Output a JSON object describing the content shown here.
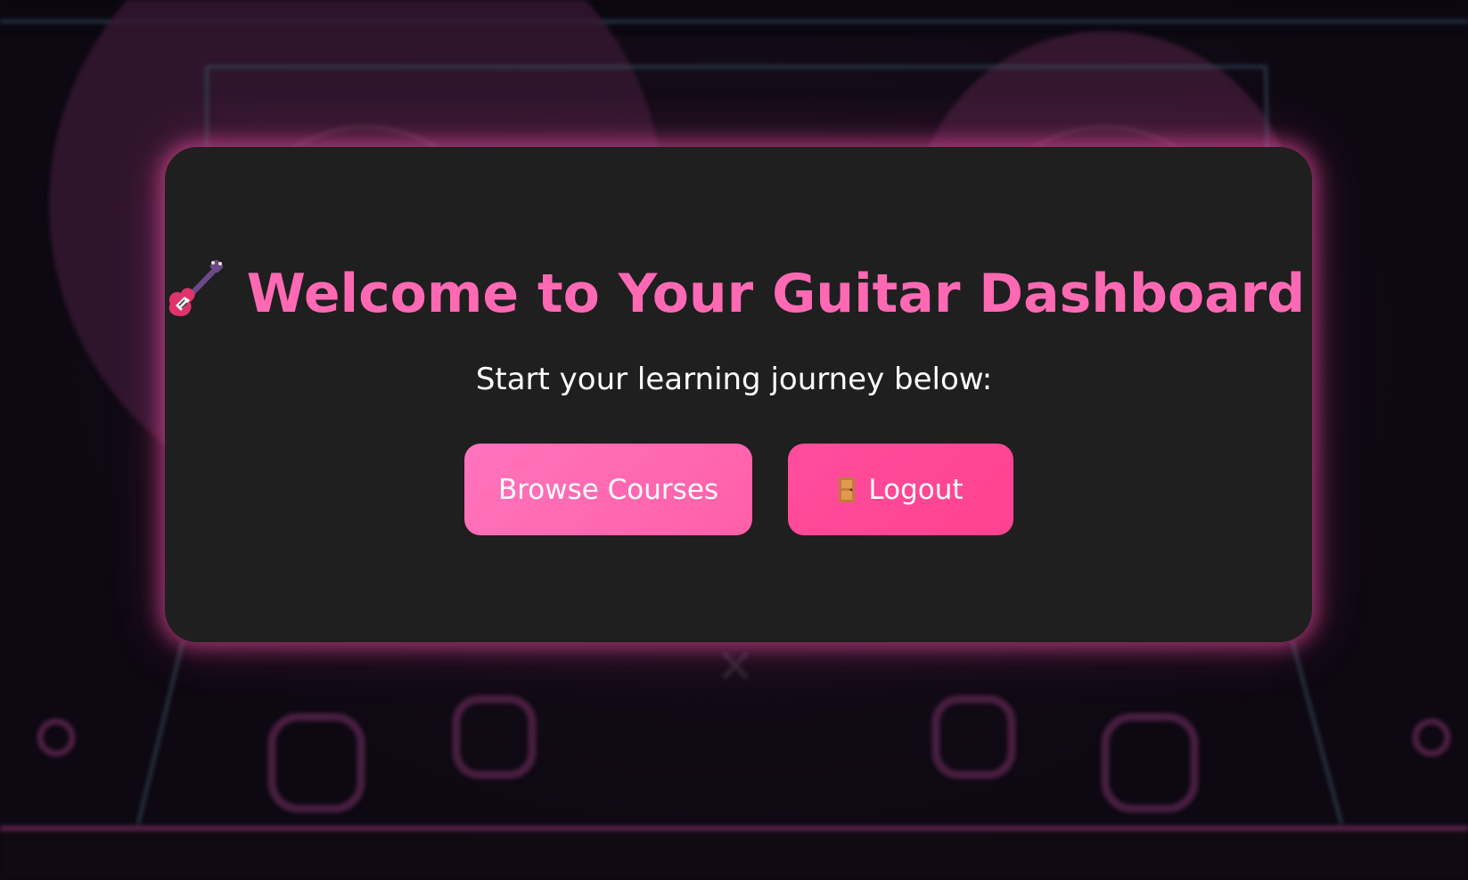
{
  "header": {
    "title": "Welcome to Your Guitar Dashboard",
    "title_icon": "guitar-icon",
    "subtitle": "Start your learning journey below:"
  },
  "actions": {
    "browse_label": "Browse Courses",
    "logout_label": "Logout",
    "logout_icon": "door-icon"
  },
  "colors": {
    "accent": "#ff69b4",
    "card_bg": "#1f1f1f",
    "page_bg": "#0d0812",
    "browse_button": "#ff6ab4",
    "logout_button": "#ff4a97",
    "glow": "#ff50aa"
  }
}
